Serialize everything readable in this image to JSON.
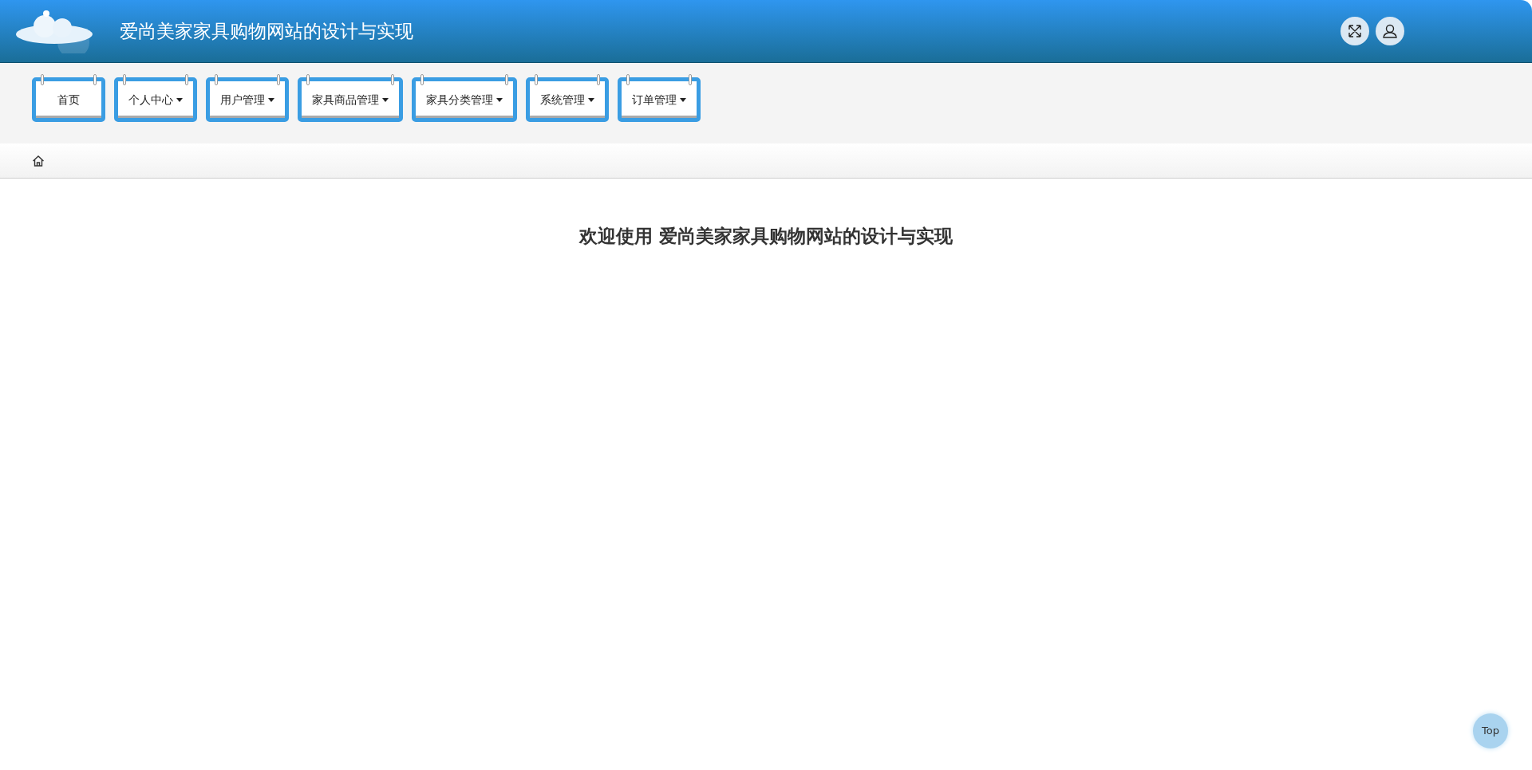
{
  "header": {
    "title": "爱尚美家家具购物网站的设计与实现"
  },
  "menu": [
    {
      "label": "首页",
      "kind": "link"
    },
    {
      "label": "个人中心",
      "kind": "dropdown"
    },
    {
      "label": "用户管理",
      "kind": "dropdown"
    },
    {
      "label": "家具商品管理",
      "kind": "dropdown"
    },
    {
      "label": "家具分类管理",
      "kind": "dropdown"
    },
    {
      "label": "系统管理",
      "kind": "dropdown"
    },
    {
      "label": "订单管理",
      "kind": "dropdown"
    }
  ],
  "welcome": "欢迎使用 爱尚美家家具购物网站的设计与实现",
  "back_to_top": "Top"
}
